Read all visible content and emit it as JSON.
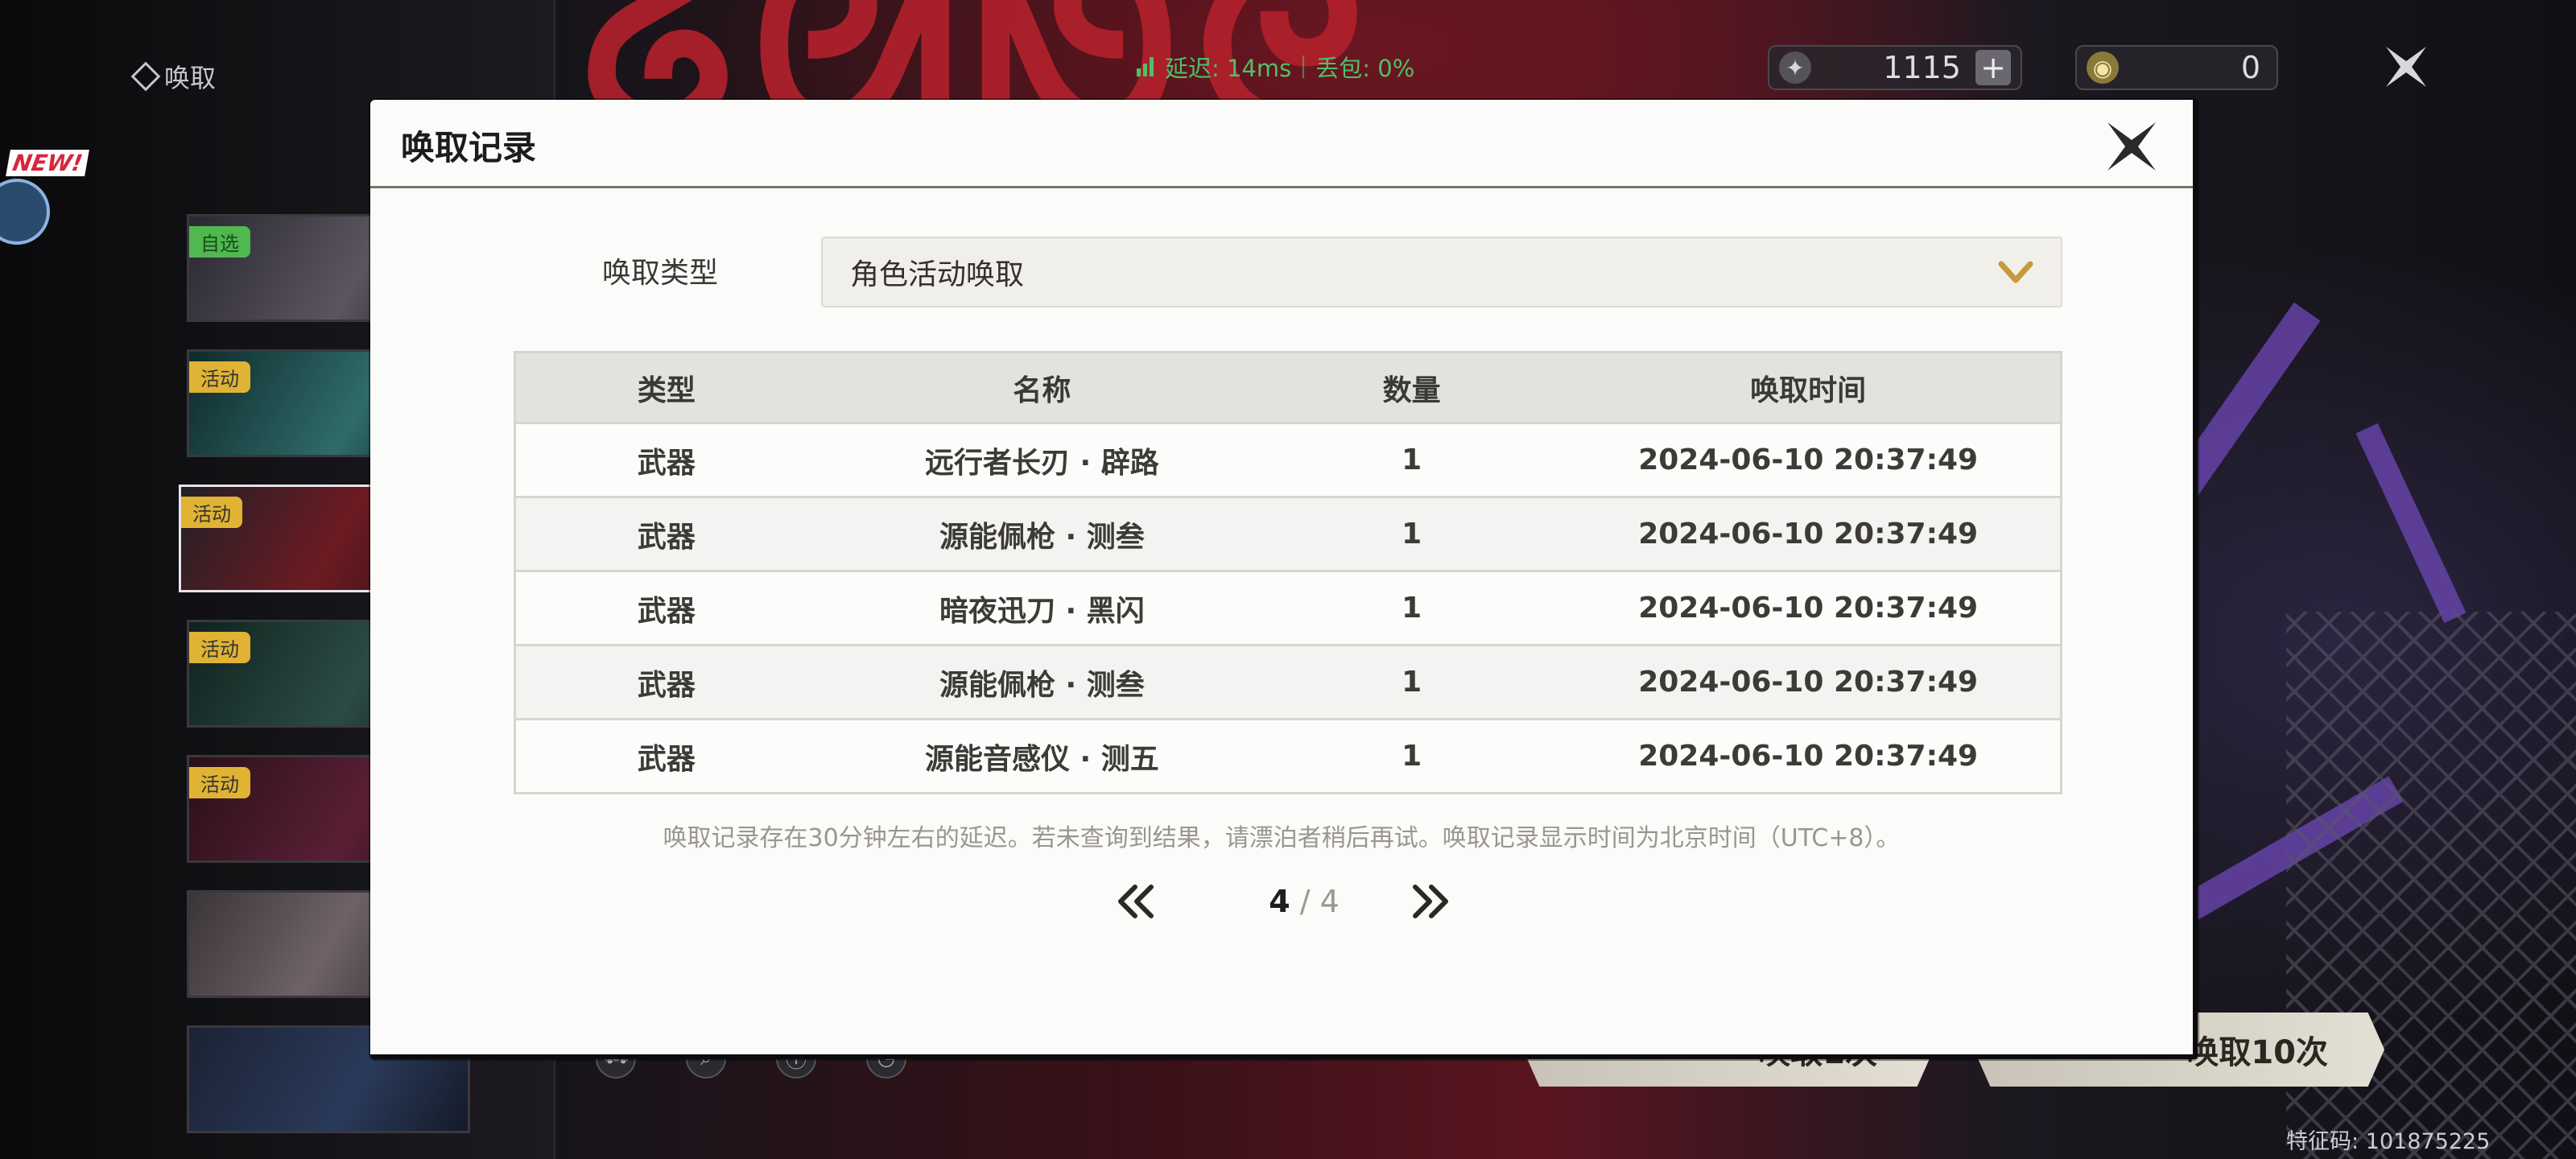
{
  "background": {
    "screen_title": "唤取",
    "net_latency": "延迟: 14ms",
    "net_loss": "丢包: 0%",
    "currency_1_value": "1115",
    "currency_1_plus": "+",
    "currency_2_value": "0",
    "new_badge": "NEW!",
    "banners": [
      {
        "tag": "自选",
        "tag_color": "#4fb84f"
      },
      {
        "tag": "活动",
        "tag_color": "#e0b334"
      },
      {
        "tag": "活动",
        "tag_color": "#e0b334"
      },
      {
        "tag": "活动",
        "tag_color": "#e0b334"
      },
      {
        "tag": "活动",
        "tag_color": "#e0b334"
      },
      {
        "tag": "",
        "tag_color": ""
      },
      {
        "tag": "",
        "tag_color": ""
      }
    ],
    "pull_1_label": "唤取1次",
    "pull_10_label": "唤取10次",
    "feature_code": "特征码: 101875225"
  },
  "modal": {
    "title": "唤取记录",
    "type_label": "唤取类型",
    "type_selected": "角色活动唤取",
    "columns": [
      "类型",
      "名称",
      "数量",
      "唤取时间"
    ],
    "rows": [
      {
        "type": "武器",
        "name": "远行者长刃 · 辟路",
        "qty": "1",
        "time": "2024-06-10 20:37:49"
      },
      {
        "type": "武器",
        "name": "源能佩枪 · 测叁",
        "qty": "1",
        "time": "2024-06-10 20:37:49"
      },
      {
        "type": "武器",
        "name": "暗夜迅刀 · 黑闪",
        "qty": "1",
        "time": "2024-06-10 20:37:49"
      },
      {
        "type": "武器",
        "name": "源能佩枪 · 测叁",
        "qty": "1",
        "time": "2024-06-10 20:37:49"
      },
      {
        "type": "武器",
        "name": "源能音感仪 · 测五",
        "qty": "1",
        "time": "2024-06-10 20:37:49"
      }
    ],
    "note": "唤取记录存在30分钟左右的延迟。若未查询到结果，请漂泊者稍后再试。唤取记录显示时间为北京时间（UTC+8）。",
    "page_current": "4",
    "page_sep_total": " / 4",
    "accent_color": "#c59a3a"
  }
}
